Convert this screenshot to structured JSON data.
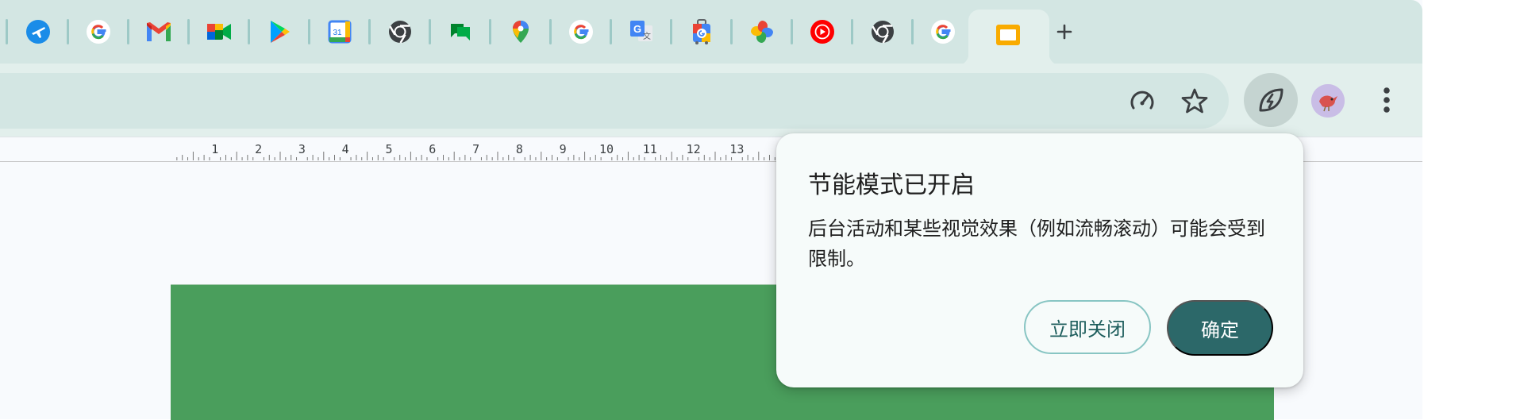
{
  "tabs": [
    {
      "name": "google-flights-icon"
    },
    {
      "name": "google-icon"
    },
    {
      "name": "gmail-icon"
    },
    {
      "name": "google-meet-icon"
    },
    {
      "name": "google-play-icon"
    },
    {
      "name": "google-calendar-icon",
      "text": "31"
    },
    {
      "name": "chrome-icon"
    },
    {
      "name": "google-chat-icon"
    },
    {
      "name": "google-maps-icon"
    },
    {
      "name": "google-icon"
    },
    {
      "name": "google-translate-icon",
      "text": "G"
    },
    {
      "name": "google-travel-icon"
    },
    {
      "name": "google-photos-icon"
    },
    {
      "name": "youtube-music-icon"
    },
    {
      "name": "chrome-icon"
    },
    {
      "name": "google-icon"
    }
  ],
  "active_tab": {
    "icon": "google-slides-icon"
  },
  "toolbar": {
    "icons": [
      "performance-gauge-icon",
      "bookmark-star-icon",
      "energy-saver-icon",
      "profile-avatar",
      "more-menu-icon"
    ]
  },
  "ruler": {
    "labels": [
      "1",
      "2",
      "3",
      "4",
      "5",
      "6",
      "7",
      "8",
      "9",
      "10",
      "11",
      "12",
      "13",
      "1"
    ]
  },
  "energy_saver_bubble": {
    "title": "节能模式已开启",
    "body": "后台活动和某些视觉效果（例如流畅滚动）可能会受到限制。",
    "dismiss_label": "立即关闭",
    "ok_label": "确定"
  },
  "colors": {
    "tabstrip": "#d3e6e3",
    "toolbar": "#e2efec",
    "accent": "#2c6869",
    "slide": "#4a9e5c"
  }
}
